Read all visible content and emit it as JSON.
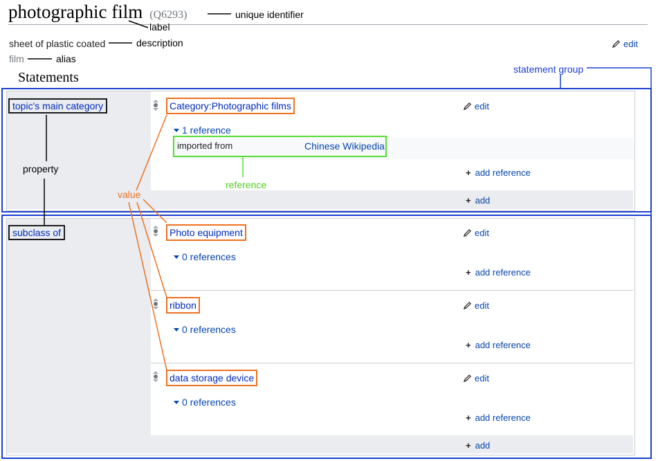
{
  "entity": {
    "label": "photographic film",
    "id": "(Q6293)",
    "description": "sheet of plastic coated",
    "alias": "film",
    "edit_label": "edit"
  },
  "statements_heading": "Statements",
  "groups": [
    {
      "property": "topic's main category",
      "statements": [
        {
          "value": "Category:Photographic films",
          "edit_label": "edit",
          "references_toggle": "1 reference",
          "reference": {
            "property": "imported from",
            "value": "Chinese Wikipedia"
          },
          "add_reference_label": "add reference"
        }
      ],
      "add_label": "add"
    },
    {
      "property": "subclass of",
      "statements": [
        {
          "value": "Photo equipment",
          "edit_label": "edit",
          "references_toggle": "0 references",
          "add_reference_label": "add reference"
        },
        {
          "value": "ribbon",
          "edit_label": "edit",
          "references_toggle": "0 references",
          "add_reference_label": "add reference"
        },
        {
          "value": "data storage device",
          "edit_label": "edit",
          "references_toggle": "0 references",
          "add_reference_label": "add reference"
        }
      ],
      "add_label": "add"
    }
  ],
  "annotations": {
    "unique_identifier": "unique identifier",
    "label": "label",
    "description": "description",
    "alias": "alias",
    "statement_group": "statement group",
    "property": "property",
    "value": "value",
    "reference": "reference"
  },
  "colors": {
    "annotation_label": "#000000",
    "statement_group": "#1a3fd0",
    "value": "#ee7020",
    "reference": "#55dd33",
    "link": "#0645ad"
  },
  "icons": {
    "edit": "pencil-icon",
    "rank": "rank-selector-icon",
    "toggle": "triangle-down-icon",
    "add": "plus-icon"
  }
}
